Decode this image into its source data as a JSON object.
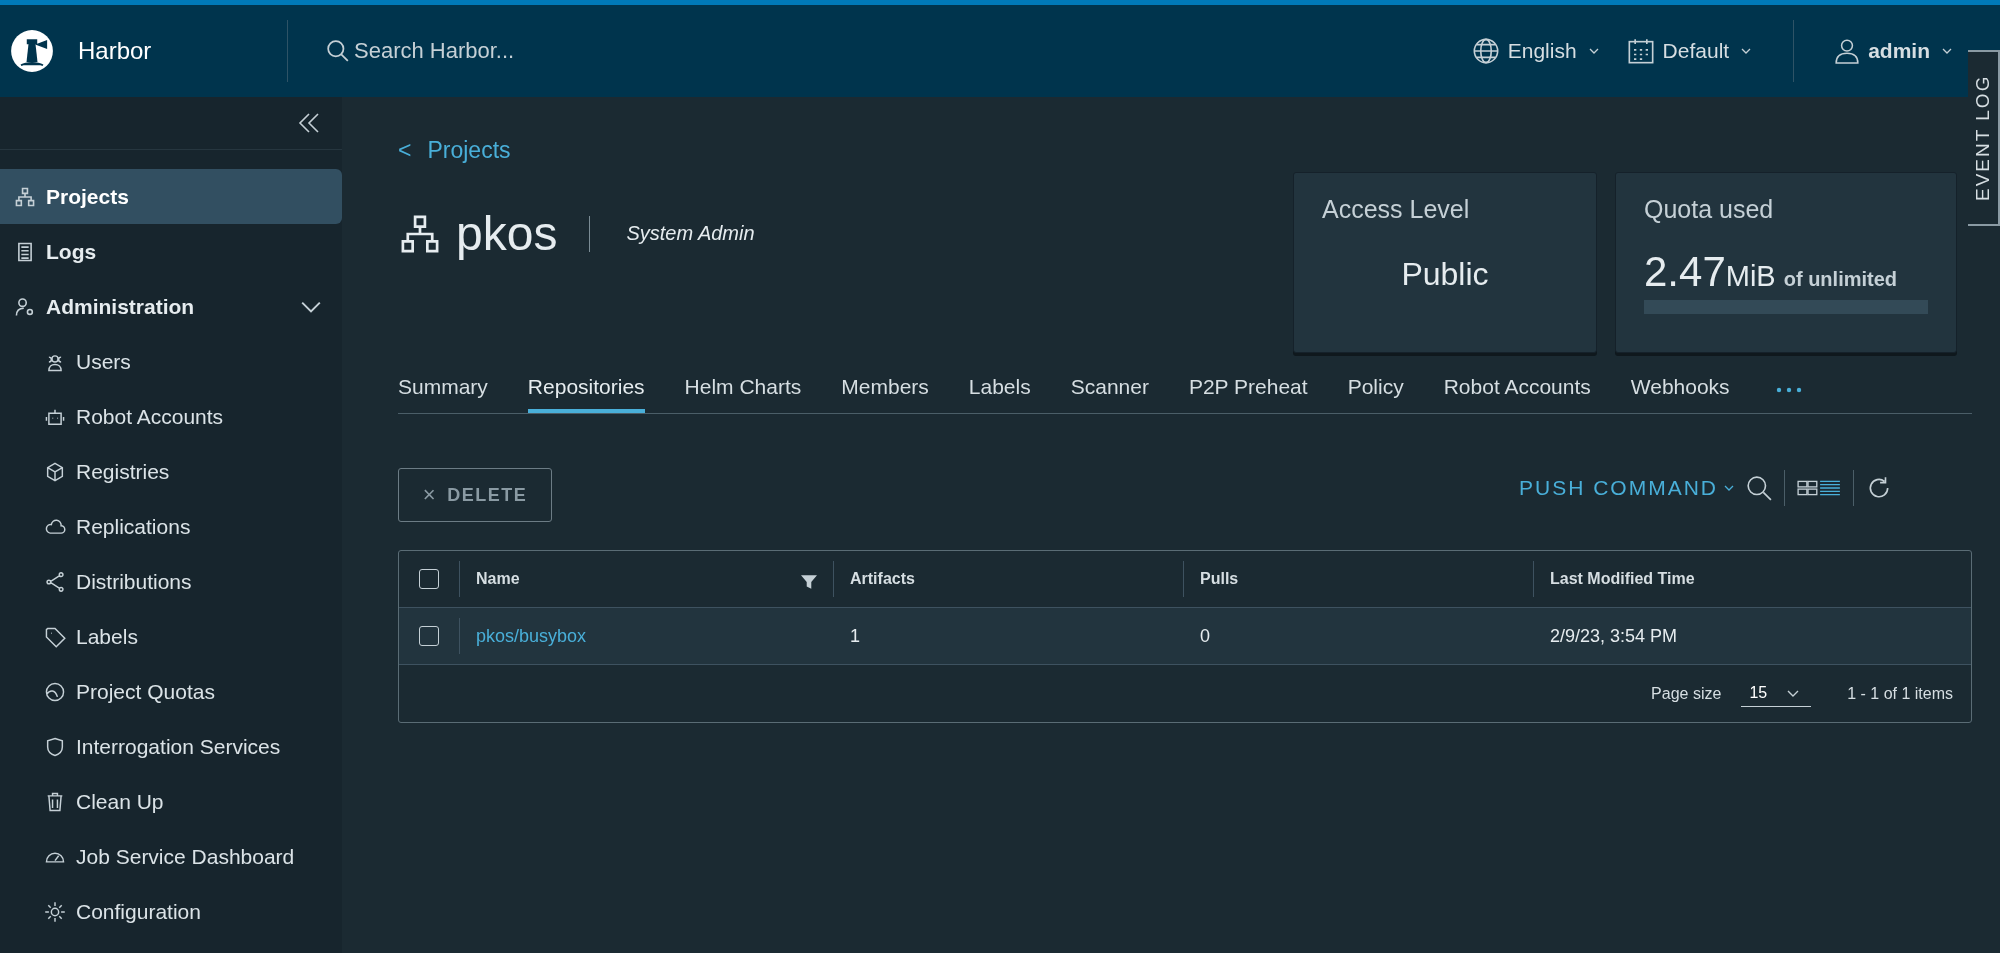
{
  "header": {
    "brand": "Harbor",
    "search": {
      "placeholder": "Search Harbor..."
    },
    "language": "English",
    "theme": "Default",
    "user": "admin"
  },
  "event_log": "EVENT LOG",
  "sidebar": {
    "items": [
      {
        "label": "Projects",
        "selected": true
      },
      {
        "label": "Logs",
        "selected": false
      },
      {
        "label": "Administration",
        "selected": false,
        "expanded": true,
        "children": [
          {
            "label": "Users",
            "selected": false
          },
          {
            "label": "Robot Accounts",
            "selected": false
          },
          {
            "label": "Registries",
            "selected": false
          },
          {
            "label": "Replications",
            "selected": false
          },
          {
            "label": "Distributions",
            "selected": false
          },
          {
            "label": "Labels",
            "selected": false
          },
          {
            "label": "Project Quotas",
            "selected": false
          },
          {
            "label": "Interrogation Services",
            "selected": false
          },
          {
            "label": "Clean Up",
            "selected": false
          },
          {
            "label": "Job Service Dashboard",
            "selected": false
          },
          {
            "label": "Configuration",
            "selected": false
          }
        ]
      }
    ]
  },
  "breadcrumb": {
    "arrow": "<",
    "label": "Projects"
  },
  "project": {
    "name": "pkos",
    "role": "System Admin"
  },
  "access_card": {
    "title": "Access Level",
    "value": "Public"
  },
  "quota_card": {
    "title": "Quota used",
    "amount": "2.47",
    "unit": "MiB",
    "suffix": "of unlimited",
    "level": 0
  },
  "tabs": [
    {
      "label": "Summary",
      "selected": false
    },
    {
      "label": "Repositories",
      "selected": true
    },
    {
      "label": "Helm Charts",
      "selected": false
    },
    {
      "label": "Members",
      "selected": false
    },
    {
      "label": "Labels",
      "selected": false
    },
    {
      "label": "Scanner",
      "selected": false
    },
    {
      "label": "P2P Preheat",
      "selected": false
    },
    {
      "label": "Policy",
      "selected": false
    },
    {
      "label": "Robot Accounts",
      "selected": false
    },
    {
      "label": "Webhooks",
      "selected": false
    }
  ],
  "toolbar": {
    "delete": {
      "icon": "×",
      "label": "DELETE",
      "disabled": true
    },
    "push_command": "PUSH COMMAND"
  },
  "table": {
    "select_all": {
      "checked": false
    },
    "columns": [
      "Name",
      "Artifacts",
      "Pulls",
      "Last Modified Time"
    ],
    "rows": [
      {
        "checked": false,
        "name": "pkos/busybox",
        "artifacts": "1",
        "pulls": "0",
        "modified": "2/9/23, 3:54 PM"
      }
    ],
    "footer": {
      "page_size_label": "Page size",
      "page_size": "15",
      "range": "1 - 1 of 1 items"
    }
  }
}
